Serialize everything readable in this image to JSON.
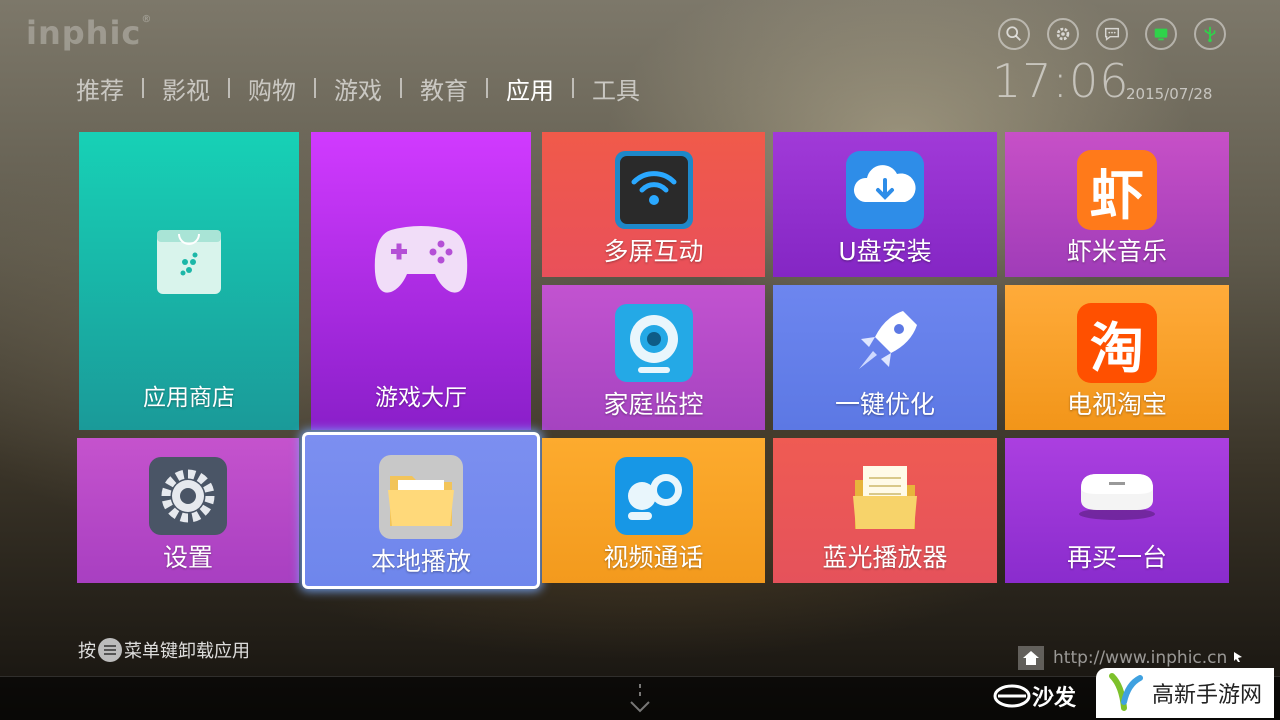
{
  "brand": {
    "logo_text": "inphic",
    "logo_mark": "®"
  },
  "nav": {
    "tabs": [
      {
        "label": "推荐",
        "active": false
      },
      {
        "label": "影视",
        "active": false
      },
      {
        "label": "购物",
        "active": false
      },
      {
        "label": "游戏",
        "active": false
      },
      {
        "label": "教育",
        "active": false
      },
      {
        "label": "应用",
        "active": true
      },
      {
        "label": "工具",
        "active": false
      }
    ]
  },
  "status_bar": {
    "icons": [
      "search-icon",
      "gear-icon",
      "message-icon",
      "screen-icon",
      "usb-icon"
    ],
    "time": "17:06",
    "date": "2015/07/28"
  },
  "tiles": [
    {
      "name": "app-store",
      "label": "应用商店",
      "icon": "shopping-bag-icon",
      "color_top": "#17d1b6",
      "color_bottom": "#1a9a99"
    },
    {
      "name": "game-hall",
      "label": "游戏大厅",
      "icon": "gamepad-icon",
      "color_top": "#d13aff",
      "color_bottom": "#8a1fc9"
    },
    {
      "name": "multi-screen",
      "label": "多屏互动",
      "icon": "wifi-screen-icon",
      "color_top": "#f05a4a",
      "color_bottom": "#e9505a"
    },
    {
      "name": "usb-install",
      "label": "U盘安装",
      "icon": "cloud-download-icon",
      "color_top": "#a13ad8",
      "color_bottom": "#8426c4"
    },
    {
      "name": "xiami-music",
      "label": "虾米音乐",
      "icon": "xiami-icon",
      "icon_text": "虾",
      "color_top": "#c750c7",
      "color_bottom": "#a03cb8"
    },
    {
      "name": "home-monitor",
      "label": "家庭监控",
      "icon": "webcam-icon",
      "color_top": "#c253d0",
      "color_bottom": "#a543c0"
    },
    {
      "name": "one-key-optimize",
      "label": "一键优化",
      "icon": "rocket-icon",
      "color_top": "#6d86ef",
      "color_bottom": "#5c78e4"
    },
    {
      "name": "tv-taobao",
      "label": "电视淘宝",
      "icon": "taobao-icon",
      "icon_text": "淘",
      "color_top": "#ffab3a",
      "color_bottom": "#f29519"
    },
    {
      "name": "settings",
      "label": "设置",
      "icon": "gear-icon",
      "color_top": "#c553cd",
      "color_bottom": "#a83fc1"
    },
    {
      "name": "local-play",
      "label": "本地播放",
      "icon": "folder-icon",
      "color_top": "#7c8ff0",
      "color_bottom": "#6e86ec"
    },
    {
      "name": "video-call",
      "label": "视频通话",
      "icon": "video-chat-icon",
      "color_top": "#fdab2e",
      "color_bottom": "#f39a1d"
    },
    {
      "name": "bluray-player",
      "label": "蓝光播放器",
      "icon": "document-folder-icon",
      "color_top": "#ef5b53",
      "color_bottom": "#e5525b"
    },
    {
      "name": "buy-another",
      "label": "再买一台",
      "icon": "tv-box-icon",
      "color_top": "#ab3fe0",
      "color_bottom": "#8a2ccd"
    }
  ],
  "footer": {
    "hint_before": "按",
    "hint_after": "菜单键卸载应用",
    "url": "http://www.inphic.cn",
    "sofa_text": "沙发",
    "watermark_text": "高新手游网"
  }
}
